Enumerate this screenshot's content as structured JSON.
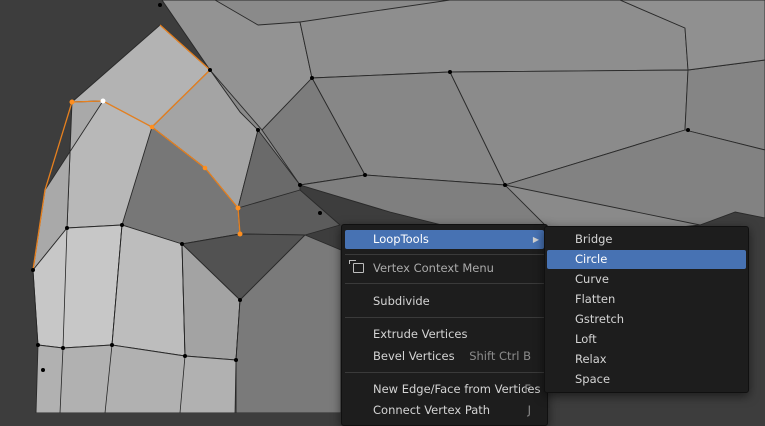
{
  "context_menu": {
    "items": [
      {
        "label": "LoopTools",
        "shortcut": "",
        "highlighted": true,
        "has_submenu": true
      },
      {
        "label": "Vertex Context Menu",
        "shortcut": "",
        "icon": "pin-menu-icon"
      },
      {
        "label": "Subdivide",
        "shortcut": ""
      },
      {
        "label": "Extrude Vertices",
        "shortcut": ""
      },
      {
        "label": "Bevel Vertices",
        "shortcut": "Shift Ctrl B"
      },
      {
        "label": "New Edge/Face from Vertices",
        "shortcut": "F"
      },
      {
        "label": "Connect Vertex Path",
        "shortcut": "J"
      }
    ]
  },
  "loop_tools_menu": {
    "items": [
      {
        "label": "Bridge"
      },
      {
        "label": "Circle",
        "highlighted": true
      },
      {
        "label": "Curve"
      },
      {
        "label": "Flatten"
      },
      {
        "label": "Gstretch"
      },
      {
        "label": "Loft"
      },
      {
        "label": "Relax"
      },
      {
        "label": "Space"
      }
    ]
  },
  "colors": {
    "background": "#3d3d3d",
    "menu_bg": "#1d1d1d",
    "highlight": "#4772b3",
    "selected_edge": "#e6801f",
    "mesh_face": "#8e8e8e"
  }
}
